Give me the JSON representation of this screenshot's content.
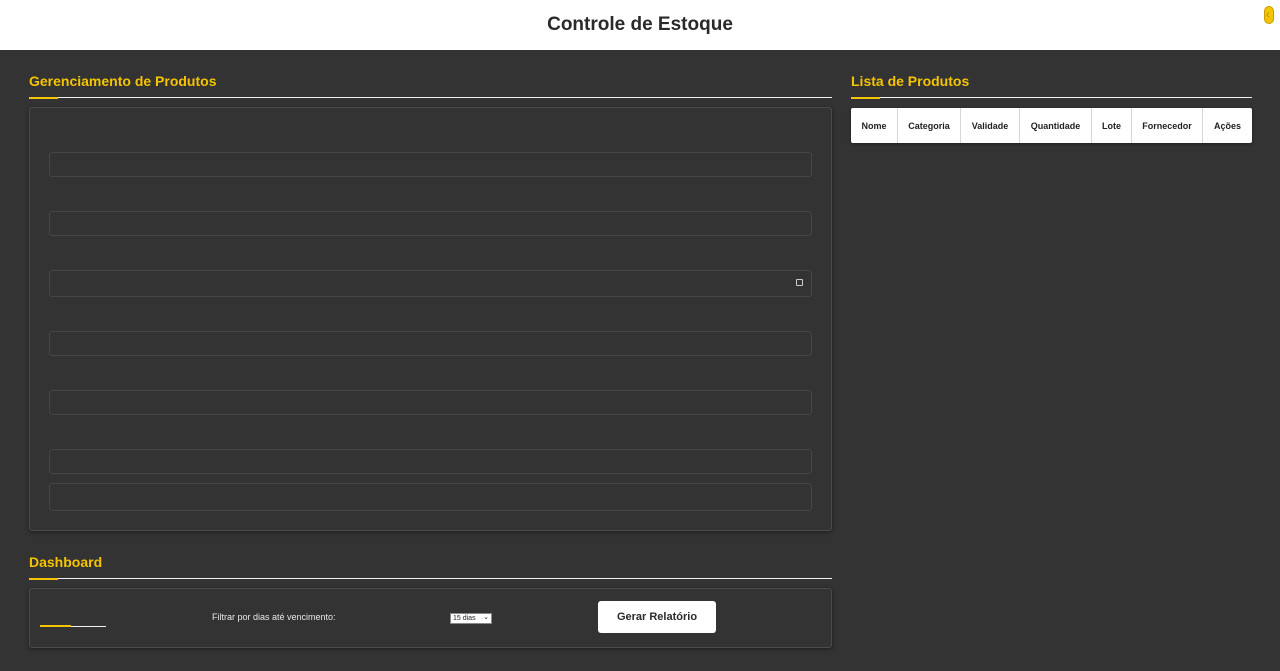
{
  "header": {
    "title": "Controle de Estoque",
    "theme_toggle_glyph": "☾",
    "theme_toggle_color": "#f5c400"
  },
  "product_management": {
    "title": "Gerenciamento de Produtos",
    "fields": [
      {
        "type": "text",
        "value": "",
        "placeholder": ""
      },
      {
        "type": "text",
        "value": "",
        "placeholder": ""
      },
      {
        "type": "date",
        "value": "",
        "placeholder": ""
      },
      {
        "type": "text",
        "value": "",
        "placeholder": ""
      },
      {
        "type": "text",
        "value": "",
        "placeholder": ""
      },
      {
        "type": "text",
        "value": "",
        "placeholder": ""
      },
      {
        "type": "text",
        "value": "",
        "placeholder": ""
      }
    ]
  },
  "product_list": {
    "title": "Lista de Produtos",
    "columns": [
      "Nome",
      "Categoria",
      "Validade",
      "Quantidade",
      "Lote",
      "Fornecedor",
      "Ações"
    ],
    "rows": []
  },
  "dashboard": {
    "title": "Dashboard",
    "progress_fraction": 0.47,
    "filter_label": "Filtrar por dias até vencimento:",
    "filter_selected": "15 dias",
    "report_button": "Gerar Relatório"
  },
  "colors": {
    "background": "#333333",
    "accent": "#f5c400",
    "header_bg": "#ffffff"
  }
}
